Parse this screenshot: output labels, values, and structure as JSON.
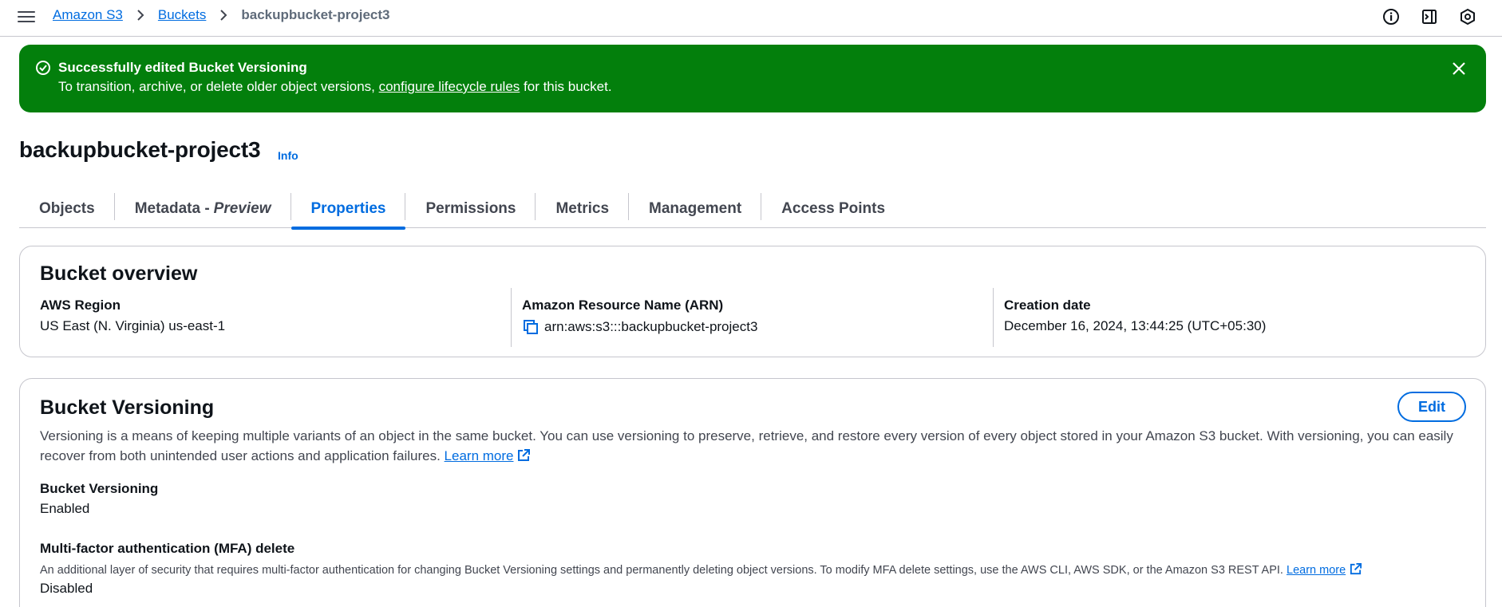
{
  "breadcrumb": {
    "items": [
      "Amazon S3",
      "Buckets"
    ],
    "current": "backupbucket-project3"
  },
  "top_icons": [
    "info-circle-icon",
    "side-panel-icon",
    "settings-shield-icon"
  ],
  "flash": {
    "title": "Successfully edited Bucket Versioning",
    "body_prefix": "To transition, archive, or delete older object versions, ",
    "body_link": "configure lifecycle rules",
    "body_suffix": " for this bucket.",
    "color": "#037f0c"
  },
  "page": {
    "title": "backupbucket-project3",
    "info_label": "Info"
  },
  "tabs": [
    {
      "label": "Objects"
    },
    {
      "label": "Metadata -",
      "suffix": "Preview"
    },
    {
      "label": "Properties",
      "active": true
    },
    {
      "label": "Permissions"
    },
    {
      "label": "Metrics"
    },
    {
      "label": "Management"
    },
    {
      "label": "Access Points"
    }
  ],
  "overview": {
    "heading": "Bucket overview",
    "region_label": "AWS Region",
    "region_value": "US East (N. Virginia) us-east-1",
    "arn_label": "Amazon Resource Name (ARN)",
    "arn_value": "arn:aws:s3:::backupbucket-project3",
    "created_label": "Creation date",
    "created_value": "December 16, 2024, 13:44:25 (UTC+05:30)"
  },
  "versioning": {
    "heading": "Bucket Versioning",
    "edit_label": "Edit",
    "description": "Versioning is a means of keeping multiple variants of an object in the same bucket. You can use versioning to preserve, retrieve, and restore every version of every object stored in your Amazon S3 bucket. With versioning, you can easily recover from both unintended user actions and application failures.",
    "learn_more": "Learn more",
    "status_label": "Bucket Versioning",
    "status_value": "Enabled",
    "mfa_label": "Multi-factor authentication (MFA) delete",
    "mfa_description": "An additional layer of security that requires multi-factor authentication for changing Bucket Versioning settings and permanently deleting object versions. To modify MFA delete settings, use the AWS CLI, AWS SDK, or the Amazon S3 REST API.",
    "mfa_learn_more": "Learn more",
    "mfa_value": "Disabled"
  },
  "colors": {
    "accent": "#006ce0",
    "success": "#037f0c",
    "border": "#c6c6cd"
  }
}
